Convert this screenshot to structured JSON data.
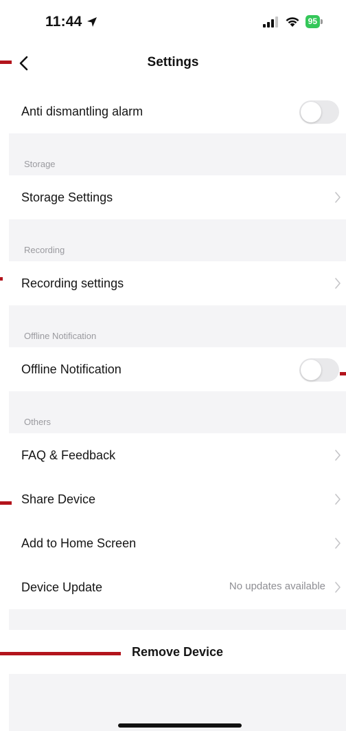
{
  "status_bar": {
    "time": "11:44",
    "location_icon": "location-arrow-icon",
    "signal_icon": "cellular-signal-icon",
    "wifi_icon": "wifi-icon",
    "battery_level": "95"
  },
  "nav": {
    "title": "Settings",
    "back_icon": "chevron-left-icon"
  },
  "rows": {
    "anti_dismantling": {
      "label": "Anti dismantling alarm",
      "toggle_on": false
    },
    "storage_settings": {
      "label": "Storage Settings"
    },
    "recording_settings": {
      "label": "Recording settings"
    },
    "offline_notification": {
      "label": "Offline Notification",
      "toggle_on": false
    },
    "faq": {
      "label": "FAQ & Feedback"
    },
    "share_device": {
      "label": "Share Device"
    },
    "add_home_screen": {
      "label": "Add to Home Screen"
    },
    "device_update": {
      "label": "Device Update",
      "value": "No updates available"
    }
  },
  "sections": {
    "storage": "Storage",
    "recording": "Recording",
    "offline": "Offline Notification",
    "others": "Others"
  },
  "remove": {
    "label": "Remove Device"
  },
  "colors": {
    "accent_marker": "#b3141c",
    "toggle_off": "#e9e9eb",
    "section_bg": "#f4f4f6",
    "battery": "#34c759"
  }
}
